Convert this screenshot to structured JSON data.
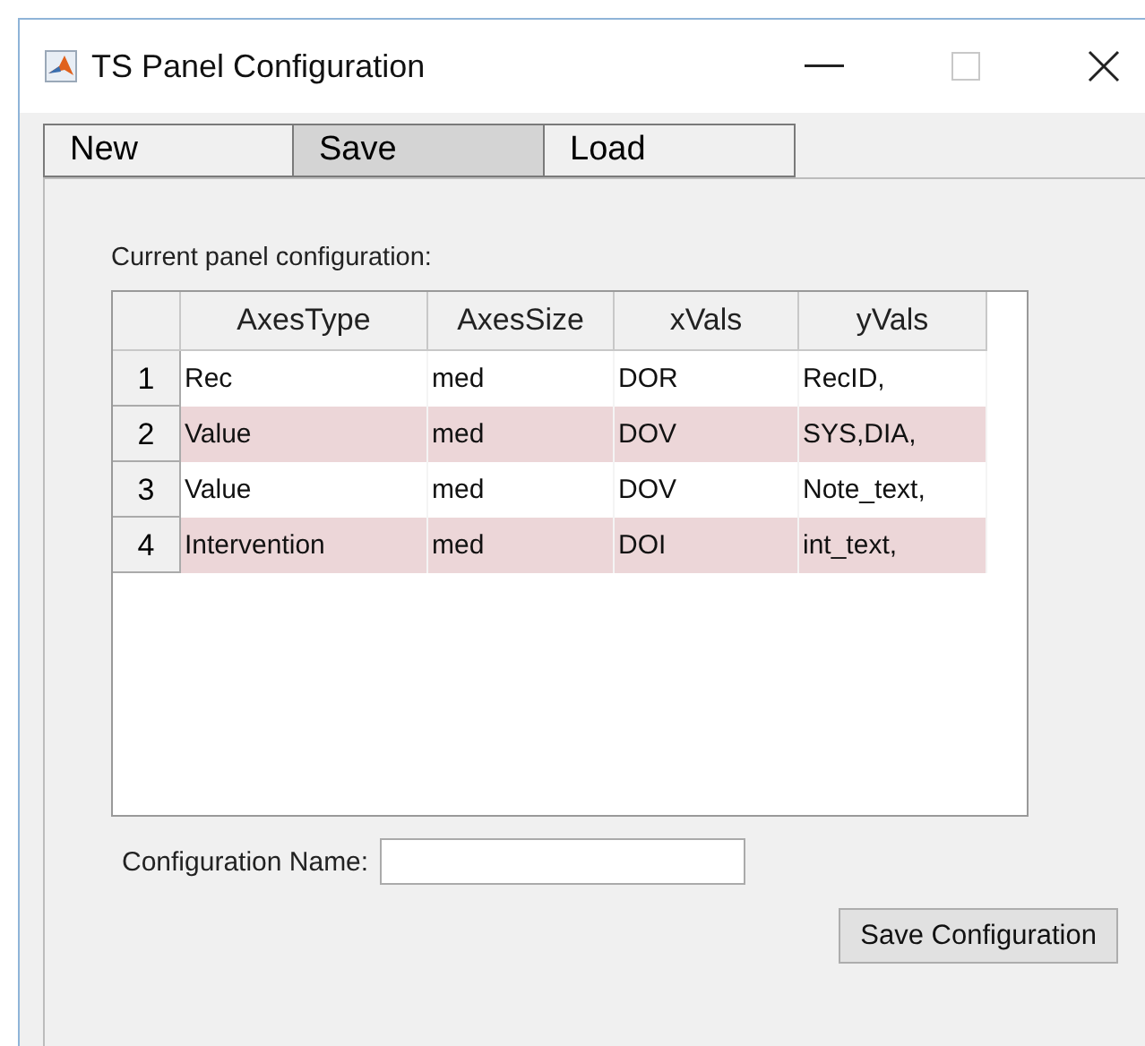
{
  "window": {
    "title": "TS Panel Configuration"
  },
  "tabs": [
    {
      "label": "New",
      "selected": false
    },
    {
      "label": "Save",
      "selected": true
    },
    {
      "label": "Load",
      "selected": false
    }
  ],
  "table": {
    "caption": "Current panel configuration:",
    "columns": [
      "AxesType",
      "AxesSize",
      "xVals",
      "yVals"
    ],
    "rows": [
      {
        "number": "1",
        "cells": [
          "Rec",
          "med",
          "DOR",
          "RecID,"
        ]
      },
      {
        "number": "2",
        "cells": [
          "Value",
          "med",
          "DOV",
          "SYS,DIA,"
        ]
      },
      {
        "number": "3",
        "cells": [
          "Value",
          "med",
          "DOV",
          "Note_text,"
        ]
      },
      {
        "number": "4",
        "cells": [
          "Intervention",
          "med",
          "DOI",
          "int_text,"
        ]
      }
    ]
  },
  "name_field": {
    "label": "Configuration Name:"
  },
  "buttons": [
    "Save Configuration"
  ]
}
